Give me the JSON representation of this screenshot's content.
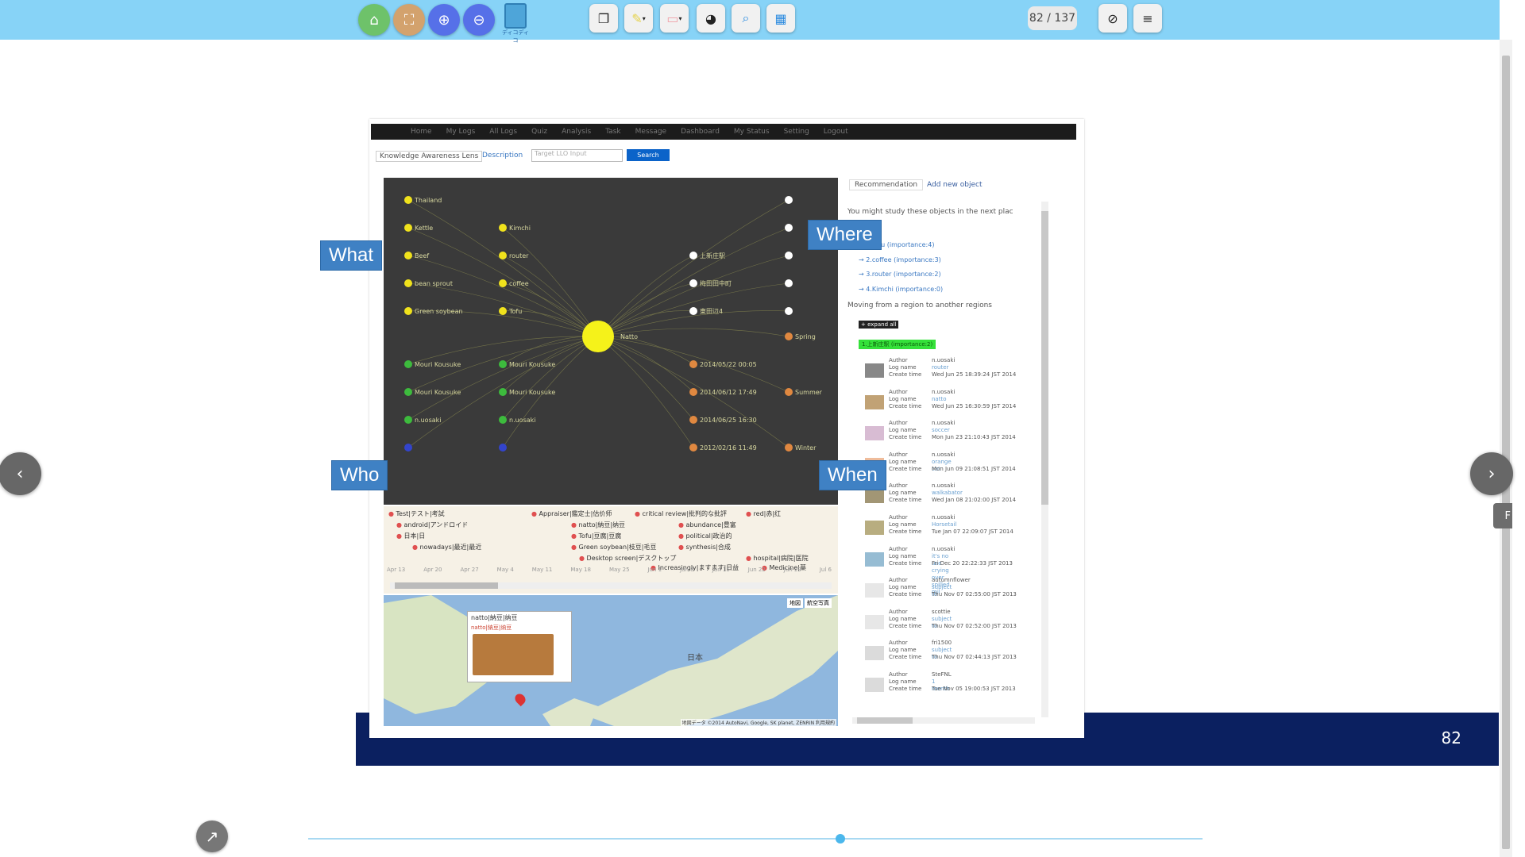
{
  "toolbar": {
    "buttons": [
      {
        "name": "home-icon",
        "color": "#6ec26a",
        "glyph": "⌂"
      },
      {
        "name": "fullscreen-icon",
        "color": "#d3a26d",
        "glyph": "⛶"
      },
      {
        "name": "zoom-in-icon",
        "color": "#5670e8",
        "glyph": "⊕"
      },
      {
        "name": "zoom-out-icon",
        "color": "#5670e8",
        "glyph": "⊖"
      }
    ],
    "logo_text": "ディコディコ",
    "tools": [
      {
        "name": "bookmark-icon",
        "glyph": "🔖"
      },
      {
        "name": "highlighter-icon",
        "glyph": "✎"
      },
      {
        "name": "eraser-icon",
        "glyph": "▭"
      },
      {
        "name": "palette-icon",
        "glyph": "◕"
      },
      {
        "name": "search-icon",
        "glyph": "⌕"
      },
      {
        "name": "grid-icon",
        "glyph": "▦"
      }
    ],
    "page_counter": "82 / 137",
    "visibility_icon": "eye-off-icon",
    "menu_icon": "hamburger-icon"
  },
  "slide": {
    "page_number": "82",
    "labels": {
      "what": "What",
      "where": "Where",
      "who": "Who",
      "when": "When"
    },
    "app": {
      "nav_items": [
        "Home",
        "My Logs",
        "All Logs",
        "Quiz",
        "Analysis",
        "Task",
        "Message",
        "Dashboard",
        "My Status",
        "Setting",
        "Logout"
      ],
      "lens_tab": "Knowledge Awareness Lens",
      "description_tab": "Description",
      "search_placeholder": "Target LLO Input",
      "search_button": "Search",
      "graph": {
        "center_label": "Natto",
        "what_col1": [
          "Thailand",
          "Kettle",
          "Beef",
          "bean sprout",
          "Green soybean"
        ],
        "what_col2": [
          "Kimchi",
          "router",
          "coffee",
          "Tofu"
        ],
        "who_col1": [
          "Mouri Kousuke",
          "Mouri Kousuke",
          "n.uosaki"
        ],
        "who_col2": [
          "Mouri Kousuke",
          "Mouri Kousuke",
          "n.uosaki"
        ],
        "where": [
          "上新庄駅",
          "梅田田中町",
          "東田辺4"
        ],
        "when": [
          "2014/05/22 00:05",
          "2014/06/12 17:49",
          "2014/06/25 16:30",
          "2012/02/16 11:49"
        ],
        "seasons": [
          "Spring",
          "Summer",
          "Winter"
        ]
      },
      "timeline": {
        "tags": [
          "Test|テスト|考試",
          "android|アンドロイド",
          "日本|日",
          "nowadays|最近|最近",
          "Appraiser|鑑定士|估价师",
          "natto|納豆|纳豆",
          "Tofu|豆腐|豆腐",
          "Green soybean|枝豆|毛豆",
          "critical review|批判的な批評",
          "abundance|豊富",
          "political|政治的",
          "synthesis|合成",
          "Desktop screen|デスクトップ",
          "Increasingly|ますます|日益",
          "red|赤|红",
          "hospital|病院|医院",
          "Medicine|薬"
        ],
        "dates": [
          "Apr 13",
          "Apr 20",
          "Apr 27",
          "May 4",
          "May 11",
          "May 18",
          "May 25",
          "Jun 1",
          "Jun 8",
          "Jun 15",
          "Jun 22",
          "Jun 29",
          "Jul 6"
        ]
      },
      "map": {
        "popup_title": "natto|納豆|纳豆",
        "popup_sub": "natto|納豆|纳豆",
        "map_buttons": [
          "地図",
          "航空写真"
        ],
        "country_label": "日本",
        "attribution": "地図データ ©2014 AutoNavi, Google, SK planet, ZENRIN 利用規約"
      },
      "right": {
        "tab_recommendation": "Recommendation",
        "tab_add": "Add new object",
        "recommend_title": "You might study these objects in the next plac",
        "recommendations": [
          "1.Tofu (importance:4)",
          "2.coffee (importance:3)",
          "3.router (importance:2)",
          "4.Kimchi (importance:0)"
        ],
        "moving_title": "Moving from a region to another regions",
        "expand_all": "+ expand all",
        "region_highlight": "1.上新庄駅 (importance:2)",
        "logs": [
          {
            "author": "n.uosaki",
            "log": "router",
            "time": "Wed Jun 25 18:39:24 JST 2014"
          },
          {
            "author": "n.uosaki",
            "log": "natto",
            "time": "Wed Jun 25 16:30:59 JST 2014"
          },
          {
            "author": "n.uosaki",
            "log": "soccer",
            "time": "Mon Jun 23 21:10:43 JST 2014"
          },
          {
            "author": "n.uosaki",
            "log": "orange cat",
            "time": "Mon Jun 09 21:08:51 JST 2014"
          },
          {
            "author": "n.uosaki",
            "log": "walkabator",
            "time": "Wed Jan 08 21:02:00 JST 2014"
          },
          {
            "author": "n.uosaki",
            "log": "Horsetail",
            "time": "Tue Jan 07 22:09:07 JST 2014"
          },
          {
            "author": "n.uosaki",
            "log": "it's no use crying over spilled mil",
            "time": "Fri Dec 20 22:22:33 JST 2013"
          },
          {
            "author": "autumnflower",
            "log": "subject to",
            "time": "Thu Nov 07 02:55:00 JST 2013"
          },
          {
            "author": "scottie",
            "log": "subject to",
            "time": "Thu Nov 07 02:52:00 JST 2013"
          },
          {
            "author": "fri1500",
            "log": "subject to",
            "time": "Thu Nov 07 02:44:13 JST 2013"
          },
          {
            "author": "SteFNL",
            "log": "1 month",
            "time": "Tue Nov 05 19:00:53 JST 2013"
          }
        ],
        "field_author": "Author",
        "field_log": "Log name",
        "field_time": "Create time"
      }
    }
  },
  "nav": {
    "prev": "‹",
    "next": "›"
  },
  "edge_tab": "F",
  "progress": {
    "fraction": 0.585
  }
}
